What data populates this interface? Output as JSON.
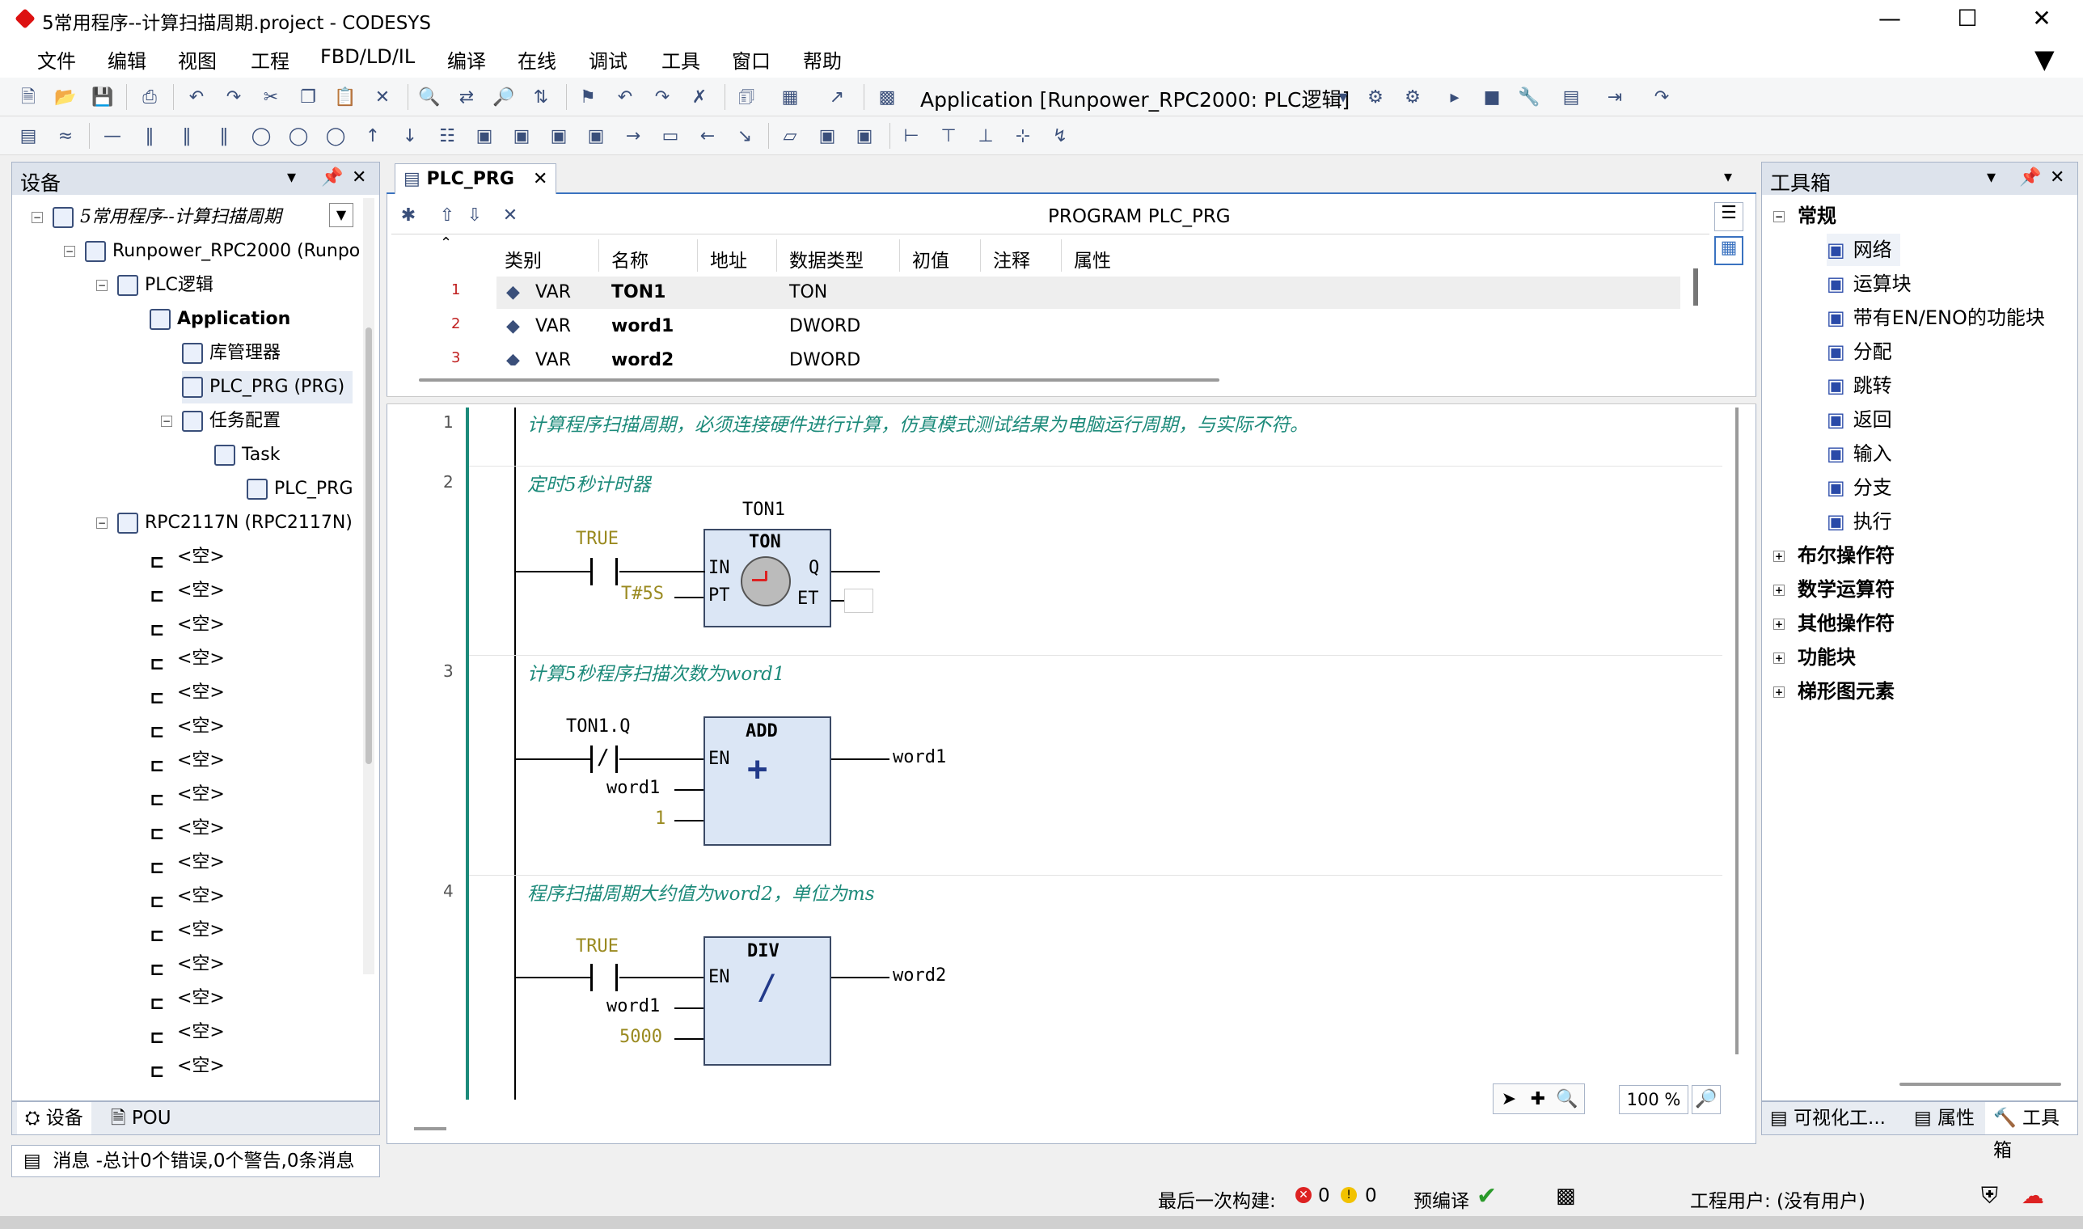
{
  "window": {
    "title": "5常用程序--计算扫描周期.project - CODESYS",
    "controls": [
      "—",
      "☐",
      "✕"
    ]
  },
  "menu": [
    "文件",
    "编辑",
    "视图",
    "工程",
    "FBD/LD/IL",
    "编译",
    "在线",
    "调试",
    "工具",
    "窗口",
    "帮助"
  ],
  "toolbar": {
    "application": "Application [Runpower_RPC2000: PLC逻辑]"
  },
  "device_panel": {
    "title": "设备",
    "tree": [
      {
        "label": "5常用程序--计算扫描周期",
        "level": 0,
        "italic": true
      },
      {
        "label": "Runpower_RPC2000 (Runpow",
        "level": 1
      },
      {
        "label": "PLC逻辑",
        "level": 2
      },
      {
        "label": "Application",
        "level": 3,
        "bold": true
      },
      {
        "label": "库管理器",
        "level": 4
      },
      {
        "label": "PLC_PRG (PRG)",
        "level": 4,
        "selected": true
      },
      {
        "label": "任务配置",
        "level": 4
      },
      {
        "label": "Task",
        "level": 5
      },
      {
        "label": "PLC_PRG",
        "level": 6
      },
      {
        "label": "RPC2117N (RPC2117N)",
        "level": 2
      },
      {
        "label": "<空>",
        "level": 3
      },
      {
        "label": "<空>",
        "level": 3
      },
      {
        "label": "<空>",
        "level": 3
      },
      {
        "label": "<空>",
        "level": 3
      },
      {
        "label": "<空>",
        "level": 3
      },
      {
        "label": "<空>",
        "level": 3
      },
      {
        "label": "<空>",
        "level": 3
      },
      {
        "label": "<空>",
        "level": 3
      },
      {
        "label": "<空>",
        "level": 3
      },
      {
        "label": "<空>",
        "level": 3
      },
      {
        "label": "<空>",
        "level": 3
      },
      {
        "label": "<空>",
        "level": 3
      },
      {
        "label": "<空>",
        "level": 3
      },
      {
        "label": "<空>",
        "level": 3
      },
      {
        "label": "<空>",
        "level": 3
      },
      {
        "label": "<空>",
        "level": 3
      }
    ],
    "bottom_tabs": [
      "设备",
      "POU"
    ]
  },
  "editor": {
    "tab": "PLC_PRG",
    "decl_title": "PROGRAM PLC_PRG",
    "columns": [
      "类别",
      "名称",
      "地址",
      "数据类型",
      "初值",
      "注释",
      "属性"
    ],
    "vars": [
      {
        "num": "1",
        "kind": "VAR",
        "name": "TON1",
        "type": "TON"
      },
      {
        "num": "2",
        "kind": "VAR",
        "name": "word1",
        "type": "DWORD"
      },
      {
        "num": "3",
        "kind": "VAR",
        "name": "word2",
        "type": "DWORD"
      }
    ],
    "networks": [
      {
        "num": "1",
        "comment": "计算程序扫描周期，必须连接硬件进行计算，仿真模式测试结果为电脑运行周期，与实际不符。"
      },
      {
        "num": "2",
        "comment": "定时5秒计时器",
        "instance": "TON1",
        "block": "TON",
        "in_label": "TRUE",
        "pt_value": "T#5S",
        "pins": {
          "in": "IN",
          "pt": "PT",
          "q": "Q",
          "et": "ET"
        }
      },
      {
        "num": "3",
        "comment": "计算5秒程序扫描次数为word1",
        "in_label": "TON1.Q",
        "block": "ADD",
        "en": "EN",
        "symbol": "+",
        "in2": "word1",
        "in3": "1",
        "out": "word1"
      },
      {
        "num": "4",
        "comment": "程序扫描周期大约值为word2，单位为ms",
        "in_label": "TRUE",
        "block": "DIV",
        "en": "EN",
        "symbol": "/",
        "in2": "word1",
        "in3": "5000",
        "out": "word2"
      }
    ],
    "zoom": "100 %"
  },
  "toolbox": {
    "title": "工具箱",
    "groups": [
      {
        "label": "常规",
        "expanded": true,
        "items": [
          "网络",
          "运算块",
          "带有EN/ENO的功能块",
          "分配",
          "跳转",
          "返回",
          "输入",
          "分支",
          "执行"
        ]
      },
      {
        "label": "布尔操作符"
      },
      {
        "label": "数学运算符"
      },
      {
        "label": "其他操作符"
      },
      {
        "label": "功能块"
      },
      {
        "label": "梯形图元素"
      }
    ],
    "bottom_tabs": [
      "可视化工...",
      "属性",
      "工具箱"
    ]
  },
  "messages_tab": "消息 -总计0个错误,0个警告,0条消息",
  "status": {
    "last_build": "最后一次构建:",
    "errors": "0",
    "warnings": "0",
    "precompile": "预编译",
    "user": "工程用户: (没有用户)"
  },
  "icon_names": [
    "filter-icon",
    "new-icon",
    "open-icon",
    "save-icon",
    "print-icon",
    "undo-icon",
    "redo-icon",
    "cut-icon",
    "copy-icon",
    "paste-icon",
    "delete-icon",
    "find-icon",
    "bookmark-icon",
    "login-icon",
    "run-icon",
    "stop-icon",
    "check-icon",
    "shield-icon",
    "cloud-icon"
  ]
}
